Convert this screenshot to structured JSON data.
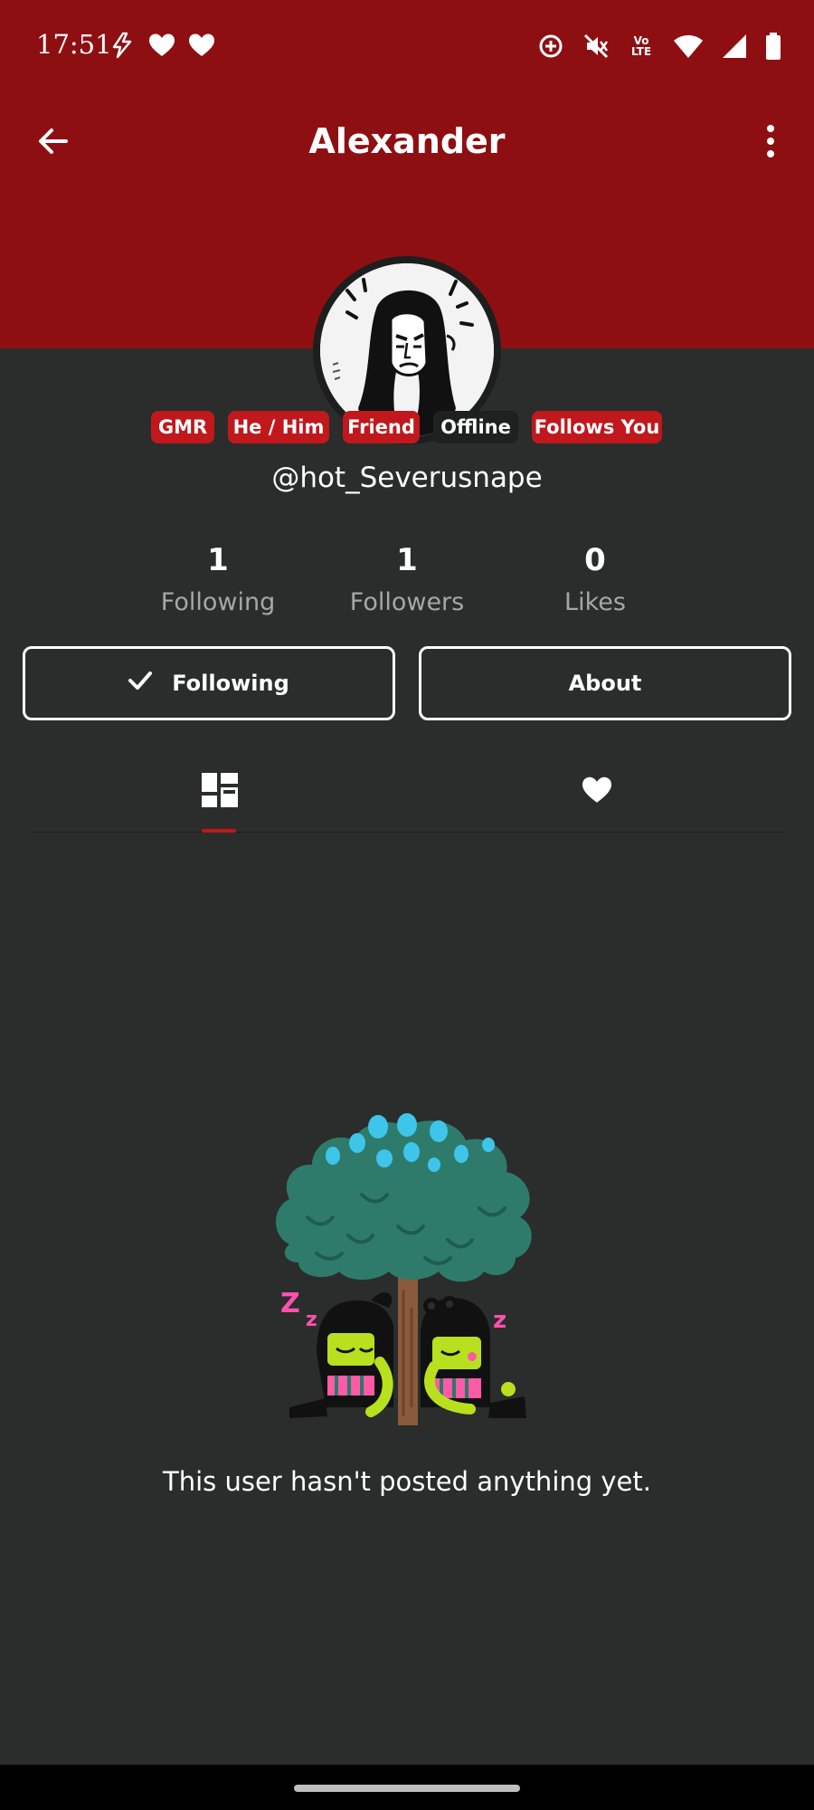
{
  "status_bar": {
    "time": "17:51",
    "left_icons": [
      "flash-icon",
      "heart-icon",
      "heart-icon"
    ],
    "volte_label": "Vo\nLTE",
    "right_icons": [
      "data-saver-icon",
      "mute-icon",
      "volte-icon",
      "wifi-icon",
      "signal-icon",
      "battery-icon"
    ]
  },
  "app_bar": {
    "title": "Alexander",
    "back_icon": "arrow-back-icon",
    "menu_icon": "more-vert-icon"
  },
  "profile": {
    "badges": [
      {
        "label": "GMR",
        "style": "red"
      },
      {
        "label": "He / Him",
        "style": "red"
      },
      {
        "label": "Friend",
        "style": "red"
      },
      {
        "label": "Offline",
        "style": "dark"
      },
      {
        "label": "Follows You",
        "style": "red"
      }
    ],
    "username": "@hot_Severusnape",
    "stats": [
      {
        "value": "1",
        "label": "Following"
      },
      {
        "value": "1",
        "label": "Followers"
      },
      {
        "value": "0",
        "label": "Likes"
      }
    ]
  },
  "actions": {
    "following_label": "Following",
    "about_label": "About"
  },
  "tabs": {
    "items": [
      {
        "name": "posts",
        "icon": "dashboard-icon",
        "selected": true
      },
      {
        "name": "likes",
        "icon": "heart-icon",
        "selected": false
      }
    ]
  },
  "empty_state": {
    "message": "This user hasn't posted anything yet."
  },
  "colors": {
    "header": "#8e0f12",
    "background": "#2a2d2b",
    "badge_red": "#c0181d",
    "badge_dark": "#1f2120",
    "muted_text": "#a4a8a6"
  }
}
